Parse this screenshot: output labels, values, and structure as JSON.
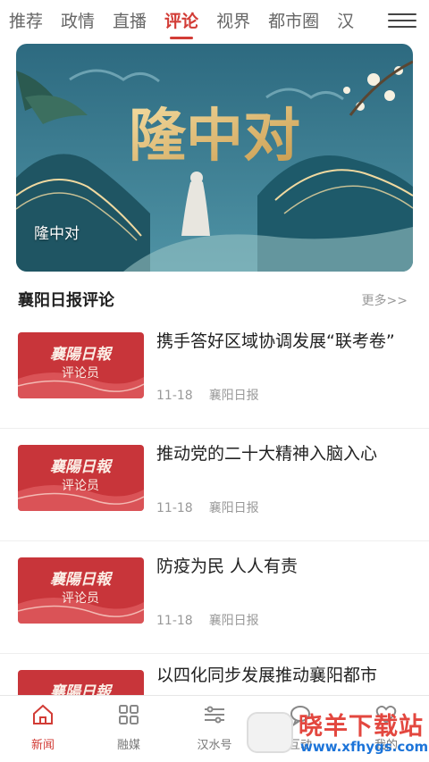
{
  "tabs": [
    {
      "label": "推荐"
    },
    {
      "label": "政情"
    },
    {
      "label": "直播"
    },
    {
      "label": "评论"
    },
    {
      "label": "视界"
    },
    {
      "label": "都市圈"
    },
    {
      "label": "汉"
    }
  ],
  "active_tab": "评论",
  "banner": {
    "art_title": "隆中对",
    "caption": "隆中对"
  },
  "section": {
    "title": "襄阳日报评论",
    "more": "更多>>"
  },
  "thumb_text": {
    "line1": "襄陽日報",
    "line2": "评论员"
  },
  "news": [
    {
      "title": "携手答好区域协调发展“联考卷”",
      "date": "11-18",
      "source": "襄阳日报"
    },
    {
      "title": "推动党的二十大精神入脑入心",
      "date": "11-18",
      "source": "襄阳日报"
    },
    {
      "title": "防疫为民 人人有责",
      "date": "11-18",
      "source": "襄阳日报"
    },
    {
      "title": "以四化同步发展推动襄阳都市",
      "date": "",
      "source": ""
    }
  ],
  "bottom_nav": [
    {
      "label": "新闻",
      "icon": "home-icon"
    },
    {
      "label": "融媒",
      "icon": "grid-icon"
    },
    {
      "label": "汉水号",
      "icon": "sliders-icon"
    },
    {
      "label": "互动",
      "icon": "chat-icon"
    },
    {
      "label": "我的",
      "icon": "heart-icon"
    }
  ],
  "watermark": {
    "name": "晓羊下载站",
    "url": "www.xfhygs.com"
  },
  "colors": {
    "accent": "#d23c36",
    "banner_bg": "#3f7f92",
    "thumb_bg": "#c8353a"
  }
}
